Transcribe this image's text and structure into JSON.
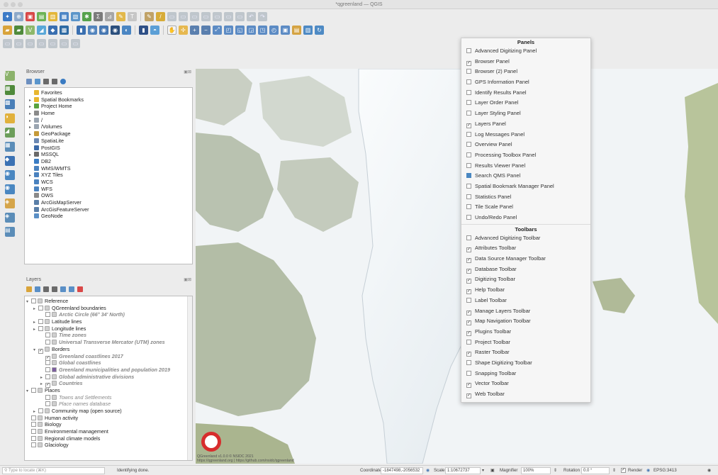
{
  "window": {
    "title": "*qgreenland — QGIS"
  },
  "browser": {
    "title": "Browser",
    "items": [
      {
        "label": "Favorites",
        "color": "#e8b730",
        "arrow": ""
      },
      {
        "label": "Spatial Bookmarks",
        "color": "#e8b730",
        "arrow": "▸"
      },
      {
        "label": "Project Home",
        "color": "#5aa33e",
        "arrow": "▸"
      },
      {
        "label": "Home",
        "color": "#8a8a8a",
        "arrow": "▸"
      },
      {
        "label": "/",
        "color": "#9aa5b1",
        "arrow": "▸"
      },
      {
        "label": "/Volumes",
        "color": "#9aa5b1",
        "arrow": "▸"
      },
      {
        "label": "GeoPackage",
        "color": "#c59a3a",
        "arrow": "▸"
      },
      {
        "label": "SpatiaLite",
        "color": "#6b88b3",
        "arrow": ""
      },
      {
        "label": "PostGIS",
        "color": "#3c6aa8",
        "arrow": ""
      },
      {
        "label": "MSSQL",
        "color": "#6a6a6a",
        "arrow": "▸"
      },
      {
        "label": "DB2",
        "color": "#3b7dc4",
        "arrow": ""
      },
      {
        "label": "WMS/WMTS",
        "color": "#4a82bf",
        "arrow": ""
      },
      {
        "label": "XYZ Tiles",
        "color": "#4a82bf",
        "arrow": "▸"
      },
      {
        "label": "WCS",
        "color": "#4a82bf",
        "arrow": ""
      },
      {
        "label": "WFS",
        "color": "#4a82bf",
        "arrow": ""
      },
      {
        "label": "OWS",
        "color": "#8a8a8a",
        "arrow": ""
      },
      {
        "label": "ArcGisMapServer",
        "color": "#5a7fa8",
        "arrow": ""
      },
      {
        "label": "ArcGisFeatureServer",
        "color": "#5a7fa8",
        "arrow": ""
      },
      {
        "label": "GeoNode",
        "color": "#5a8fc6",
        "arrow": ""
      }
    ]
  },
  "layers": {
    "title": "Layers",
    "items": [
      {
        "label": "Reference",
        "style": "n",
        "indent": 0,
        "arrow": "▾"
      },
      {
        "label": "QGreenland boundaries",
        "style": "n",
        "indent": 1,
        "arrow": "▸"
      },
      {
        "label": "Arctic Circle (66° 34' North)",
        "style": "itb",
        "indent": 2,
        "arrow": ""
      },
      {
        "label": "Latitude lines",
        "style": "n",
        "indent": 1,
        "arrow": "▸"
      },
      {
        "label": "Longitude lines",
        "style": "n",
        "indent": 1,
        "arrow": "▸"
      },
      {
        "label": "Time zones",
        "style": "itb",
        "indent": 2,
        "arrow": ""
      },
      {
        "label": "Universal Transverse Mercator (UTM) zones",
        "style": "itb",
        "indent": 2,
        "arrow": ""
      },
      {
        "label": "Borders",
        "style": "n",
        "indent": 1,
        "arrow": "▾",
        "checked": true
      },
      {
        "label": "Greenland coastlines 2017",
        "style": "itb",
        "indent": 2,
        "arrow": "",
        "checked": true
      },
      {
        "label": "Global coastlines",
        "style": "itb",
        "indent": 2,
        "arrow": ""
      },
      {
        "label": "Greenland municipalities and population 2019",
        "style": "itb",
        "indent": 2,
        "arrow": "",
        "swatch": "#7d5fa0"
      },
      {
        "label": "Global administrative divisions",
        "style": "itb",
        "indent": 2,
        "arrow": "▸"
      },
      {
        "label": "Countries",
        "style": "itb",
        "indent": 2,
        "arrow": "▸",
        "checked": true
      },
      {
        "label": "Places",
        "style": "n",
        "indent": 0,
        "arrow": "▾"
      },
      {
        "label": "Towns and Settlements",
        "style": "it",
        "indent": 2,
        "arrow": ""
      },
      {
        "label": "Place names database",
        "style": "it",
        "indent": 2,
        "arrow": ""
      },
      {
        "label": "Community map (open source)",
        "style": "n",
        "indent": 1,
        "arrow": "▸"
      },
      {
        "label": "Human activity",
        "style": "n",
        "indent": 0,
        "arrow": ""
      },
      {
        "label": "Biology",
        "style": "n",
        "indent": 0,
        "arrow": ""
      },
      {
        "label": "Environmental management",
        "style": "n",
        "indent": 0,
        "arrow": ""
      },
      {
        "label": "Regional climate models",
        "style": "n",
        "indent": 0,
        "arrow": ""
      },
      {
        "label": "Glaciology",
        "style": "n",
        "indent": 0,
        "arrow": ""
      }
    ]
  },
  "menu": {
    "panels_heading": "Panels",
    "panels": [
      {
        "label": "Advanced Digitizing Panel",
        "checked": false
      },
      {
        "label": "Browser Panel",
        "checked": true
      },
      {
        "label": "Browser (2) Panel",
        "checked": false
      },
      {
        "label": "GPS Information Panel",
        "checked": false
      },
      {
        "label": "Identify Results Panel",
        "checked": false
      },
      {
        "label": "Layer Order Panel",
        "checked": false
      },
      {
        "label": "Layer Styling Panel",
        "checked": false
      },
      {
        "label": "Layers Panel",
        "checked": true
      },
      {
        "label": "Log Messages Panel",
        "checked": false
      },
      {
        "label": "Overview Panel",
        "checked": false
      },
      {
        "label": "Processing Toolbox Panel",
        "checked": false
      },
      {
        "label": "Results Viewer Panel",
        "checked": false
      },
      {
        "label": "Search QMS Panel",
        "checked": false,
        "icon": true
      },
      {
        "label": "Spatial Bookmark Manager Panel",
        "checked": false
      },
      {
        "label": "Statistics Panel",
        "checked": false
      },
      {
        "label": "Tile Scale Panel",
        "checked": false
      },
      {
        "label": "Undo/Redo Panel",
        "checked": false
      }
    ],
    "toolbars_heading": "Toolbars",
    "toolbars": [
      {
        "label": "Advanced Digitizing Toolbar",
        "checked": false
      },
      {
        "label": "Attributes Toolbar",
        "checked": true
      },
      {
        "label": "Data Source Manager Toolbar",
        "checked": true
      },
      {
        "label": "Database Toolbar",
        "checked": true
      },
      {
        "label": "Digitizing Toolbar",
        "checked": true
      },
      {
        "label": "Help Toolbar",
        "checked": true
      },
      {
        "label": "Label Toolbar",
        "checked": false
      },
      {
        "label": "Manage Layers Toolbar",
        "checked": true
      },
      {
        "label": "Map Navigation Toolbar",
        "checked": true
      },
      {
        "label": "Plugins Toolbar",
        "checked": true
      },
      {
        "label": "Project Toolbar",
        "checked": false
      },
      {
        "label": "Raster Toolbar",
        "checked": true
      },
      {
        "label": "Shape Digitizing Toolbar",
        "checked": false
      },
      {
        "label": "Snapping Toolbar",
        "checked": false
      },
      {
        "label": "Vector Toolbar",
        "checked": true
      },
      {
        "label": "Web Toolbar",
        "checked": true
      }
    ]
  },
  "map": {
    "credit1": "QGreenland v1.0.0 © NSIDC 2021",
    "credit2": "https://qgreenland.org | https://github.com/nsidc/qgreenland"
  },
  "status": {
    "locate_placeholder": "Type to locate (⌘K)",
    "message": "Identifying done.",
    "coordinate_label": "Coordinate",
    "coordinate_value": "-1847498,-2056532",
    "scale_label": "Scale",
    "scale_value": "1:10672737",
    "magnifier_label": "Magnifier",
    "magnifier_value": "100%",
    "rotation_label": "Rotation",
    "rotation_value": "0.0 °",
    "render_label": "Render",
    "crs": "EPSG:3413"
  },
  "colors": {
    "accent": "#3a6fb0",
    "ice": "#f4f7f9",
    "land": "#a7b48e",
    "ocean": "#f1f4f6"
  }
}
